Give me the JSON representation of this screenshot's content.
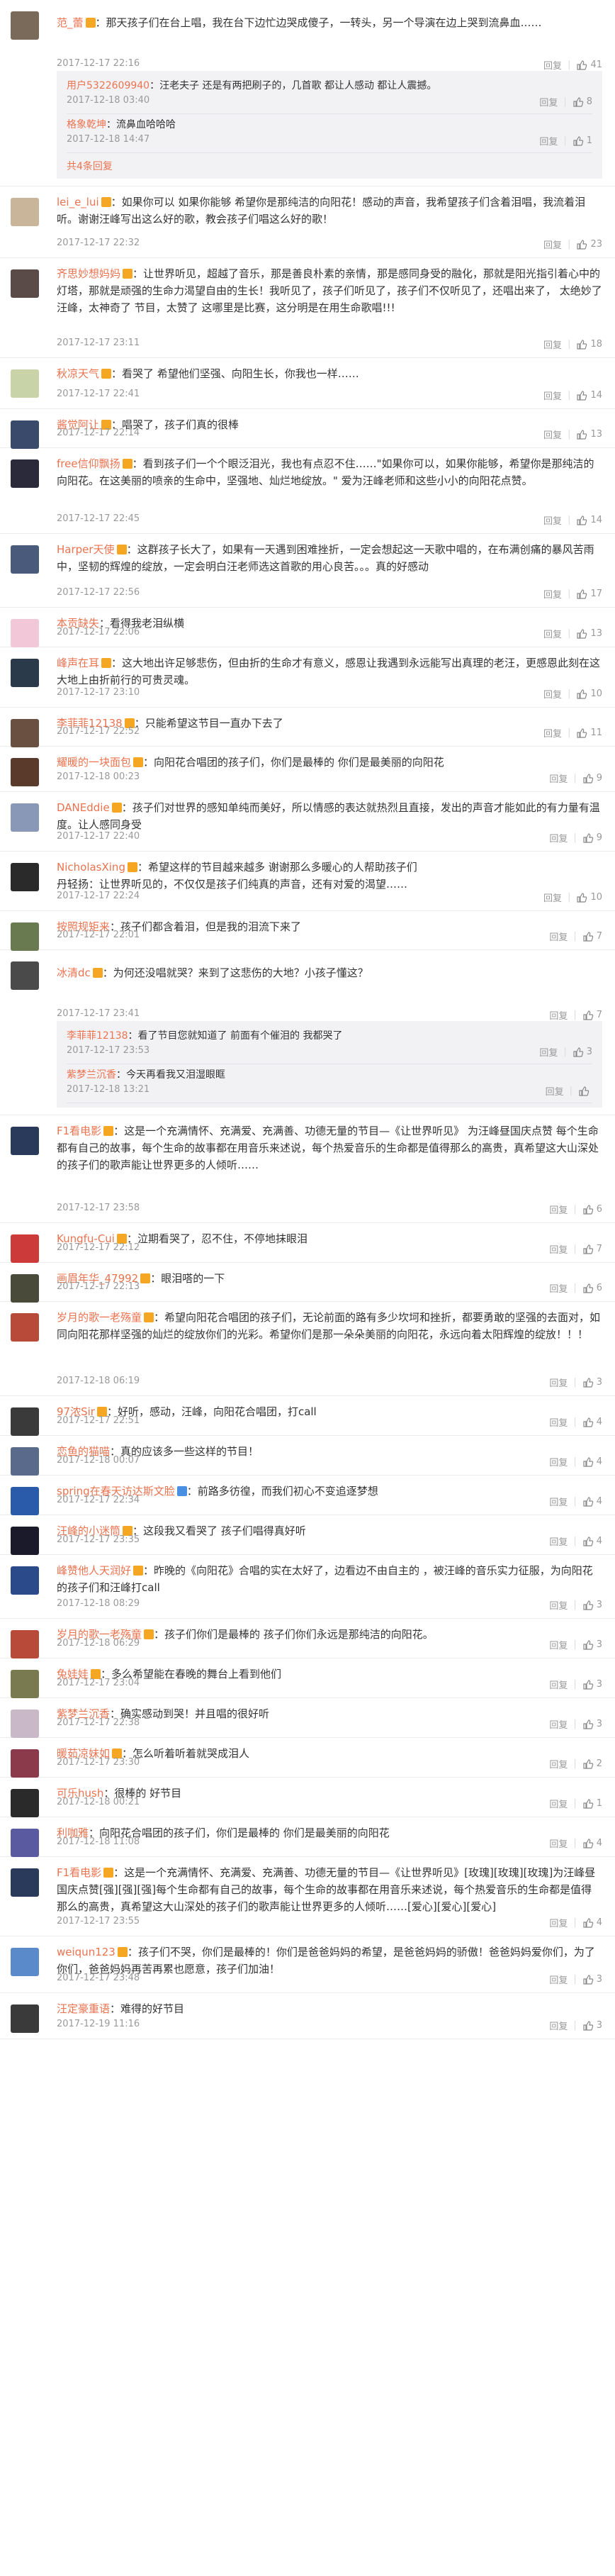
{
  "comments": [
    {
      "user": "范_蕾",
      "badge": "vip",
      "text": "：那天孩子们在台上唱，我在台下边忙边哭成傻子，一转头，另一个导演在边上哭到流鼻血……",
      "time": "2017-12-17 22:16",
      "reply": "回复",
      "likes": "41",
      "av": "#7a6a5a",
      "replies": [
        {
          "user": "用户5322609940",
          "text": "：汪老夫子 还是有两把刷子的，几首歌 都让人感动 都让人震撼。",
          "time": "2017-12-18 03:40",
          "reply": "回复",
          "likes": "8"
        },
        {
          "user": "格象乾坤",
          "text": "：流鼻血哈哈哈",
          "time": "2017-12-18 14:47",
          "reply": "回复",
          "likes": "1"
        }
      ],
      "more": "共4条回复"
    },
    {
      "user": "lei_e_lui",
      "badge": "vip",
      "text": "：如果你可以 如果你能够 希望你是那纯洁的向阳花！感动的声音，我希望孩子们含着泪唱，我流着泪听。谢谢汪峰写出这么好的歌，教会孩子们唱这么好的歌！",
      "time": "2017-12-17 22:32",
      "reply": "回复",
      "likes": "23",
      "av": "#c9b59a"
    },
    {
      "user": "齐思妙想妈妈",
      "badge": "vip",
      "text": "：让世界听见，超越了音乐，那是善良朴素的亲情，那是感同身受的融化，那就是阳光指引着心中的灯塔，那就是顽强的生命力渴望自由的生长！我听见了，孩子们听见了，孩子们不仅听见了，还唱出来了， 太绝妙了 汪峰，太神奇了 节目，太赞了 这哪里是比赛，这分明是在用生命歌唱!!!",
      "time": "2017-12-17 23:11",
      "reply": "回复",
      "likes": "18",
      "av": "#5a4a48"
    },
    {
      "user": "秋凉天气",
      "badge": "vip",
      "text": "：看哭了 希望他们坚强、向阳生长，你我也一样……",
      "time": "2017-12-17 22:41",
      "reply": "回复",
      "likes": "14",
      "av": "#c8d4a8"
    },
    {
      "user": "酱觉阿让",
      "badge": "vip",
      "text": "：唱哭了，孩子们真的很棒",
      "time": "2017-12-17 22:14",
      "reply": "回复",
      "likes": "13",
      "av": "#3a4a6a"
    },
    {
      "user": "free信仰飘扬",
      "badge": "vip",
      "text": "：看到孩子们一个个眼泛泪光，我也有点忍不住……\"如果你可以，如果你能够，希望你是那纯洁的向阳花。在这美丽的喷亲的生命中，坚强地、灿烂地绽放。\" 爱为汪峰老师和这些小小的向阳花点赞。",
      "time": "2017-12-17 22:45",
      "reply": "回复",
      "likes": "14",
      "av": "#2a2a3a"
    },
    {
      "user": "Harper天使",
      "badge": "vip",
      "text": "：这群孩子长大了，如果有一天遇到困难挫折，一定会想起这一天歌中唱的，在布满创痛的暴风苦雨中，坚韧的辉煌的绽放，一定会明白汪老师选这首歌的用心良苦。。。真的好感动",
      "time": "2017-12-17 22:56",
      "reply": "回复",
      "likes": "17",
      "av": "#4a5a7a"
    },
    {
      "user": "本贡缺失",
      "badge": "",
      "text": "：看得我老泪纵横",
      "time": "2017-12-17 22:06",
      "reply": "回复",
      "likes": "13",
      "av": "#f2c8d8"
    },
    {
      "user": "峰声在耳",
      "badge": "vip",
      "text": "：这大地出许足够悲伤，但由折的生命才有意义，感恩让我遇到永远能写出真理的老汪，更感恩此刻在这大地上由折前行的可贵灵魂。",
      "time": "2017-12-17 23:10",
      "reply": "回复",
      "likes": "10",
      "av": "#2a3a4a"
    },
    {
      "user": "李菲菲12138",
      "badge": "vip",
      "text": "：只能希望这节目一直办下去了",
      "time": "2017-12-17 22:52",
      "reply": "回复",
      "likes": "11",
      "av": "#6a5040"
    },
    {
      "user": "耀暖的一块面包",
      "badge": "vip",
      "text": "：向阳花合唱团的孩子们，你们是最棒的 你们是最美丽的向阳花",
      "time": "2017-12-18 00:23",
      "reply": "回复",
      "likes": "9",
      "av": "#5a3a2a"
    },
    {
      "user": "DANEddie",
      "badge": "vip",
      "text": "：孩子们对世界的感知单纯而美好，所以情感的表达就热烈且直接，发出的声音才能如此的有力量有温度。让人感同身受",
      "time": "2017-12-17 22:40",
      "reply": "回复",
      "likes": "9",
      "av": "#8a98b8"
    },
    {
      "user": "NicholasXing",
      "badge": "vip",
      "text": "：希望这样的节目越来越多 谢谢那么多暖心的人帮助孩子们",
      "sub": "丹轻扬：让世界听见的，不仅仅是孩子们纯真的声音，还有对爱的渴望……",
      "time": "2017-12-17 22:24",
      "reply": "回复",
      "likes": "10",
      "av": "#2a2a2a"
    },
    {
      "user": "按照规矩来",
      "badge": "",
      "text": "：孩子们都含着泪，但是我的泪流下来了",
      "time": "2017-12-17 22:01",
      "reply": "回复",
      "likes": "7",
      "av": "#6a7a50"
    },
    {
      "user": "冰清dc",
      "badge": "vip",
      "text": "：为何还没唱就哭？来到了这悲伤的大地？小孩子懂这？",
      "time": "2017-12-17 23:41",
      "reply": "回复",
      "likes": "7",
      "av": "#4a4a4a",
      "replies": [
        {
          "user": "李菲菲12138",
          "text": "：看了节目您就知道了 前面有个催泪的 我都哭了",
          "time": "2017-12-17 23:53",
          "reply": "回复",
          "likes": "3"
        },
        {
          "user": "紫梦兰沉香",
          "text": "：今天再看我又泪湿眼眶",
          "time": "2017-12-18 13:21",
          "reply": "回复",
          "likes": ""
        }
      ]
    },
    {
      "user": "F1看电影",
      "badge": "vip",
      "text": "：这是一个充满情怀、充满爱、充满善、功德无量的节目—《让世界听见》 为汪峰昼国庆点赞 每个生命都有自己的故事，每个生命的故事都在用音乐来述说，每个热爱音乐的生命都是值得那么的高贵，真希望这大山深处的孩子们的歌声能让世界更多的人倾听……",
      "time": "2017-12-17 23:58",
      "reply": "回复",
      "likes": "6",
      "av": "#2a3a5a"
    },
    {
      "user": "Kungfu-Cui",
      "badge": "vip",
      "text": "：泣期看哭了，忍不住，不停地抹眼泪",
      "time": "2017-12-17 22:12",
      "reply": "回复",
      "likes": "7",
      "av": "#cc3a3a"
    },
    {
      "user": "画眉年华_47992",
      "badge": "vip",
      "text": "：眼泪嗒的一下",
      "time": "2017-12-17 22:13",
      "reply": "回复",
      "likes": "6",
      "av": "#4a4a3a"
    },
    {
      "user": "岁月的歌一老殇童",
      "badge": "vip",
      "text": "：希望向阳花合唱团的孩子们，无论前面的路有多少坎坷和挫折，都要勇敢的坚强的去面对，如同向阳花那样坚强的灿烂的绽放你们的光彩。希望你们是那一朵朵美丽的向阳花，永远向着太阳辉煌的绽放！！！",
      "time": "2017-12-18 06:19",
      "reply": "回复",
      "likes": "3",
      "av": "#b84a3a"
    },
    {
      "user": "97浓Sir",
      "badge": "vip",
      "text": "：好听，感动，汪峰，向阳花合唱团，打call",
      "time": "2017-12-17 22:51",
      "reply": "回复",
      "likes": "4",
      "av": "#3a3a3a"
    },
    {
      "user": "恋鱼的猫喵",
      "badge": "",
      "text": "：真的应该多一些这样的节目！",
      "time": "2017-12-18 00:07",
      "reply": "回复",
      "likes": "4",
      "av": "#5a6a8a"
    },
    {
      "user": "spring在春天访达斯文脸",
      "badge": "v",
      "text": "：前路多彷徨，而我们初心不变追逐梦想",
      "time": "2017-12-17 22:34",
      "reply": "回复",
      "likes": "4",
      "av": "#2a5aaa"
    },
    {
      "user": "汪峰的小迷筒",
      "badge": "vip",
      "text": "：这段我又看哭了 孩子们唱得真好听",
      "time": "2017-12-17 23:35",
      "reply": "回复",
      "likes": "4",
      "av": "#1a1a2a"
    },
    {
      "user": "峰赞他人天润好",
      "badge": "vip",
      "text": "：昨晚的《向阳花》合唱的实在太好了，边看边不由自主的 ，被汪峰的音乐实力征服，为向阳花的孩子们和汪峰打call",
      "time": "2017-12-18 08:29",
      "reply": "回复",
      "likes": "3",
      "av": "#2a4a8a"
    },
    {
      "user": "岁月的歌一老殇童",
      "badge": "vip",
      "text": "：孩子们你们是最棒的 孩子们你们永远是那纯洁的向阳花。",
      "time": "2017-12-18 06:29",
      "reply": "回复",
      "likes": "3",
      "av": "#b84a3a"
    },
    {
      "user": "兔娃娃",
      "badge": "vip",
      "text": "：多么希望能在春晚的舞台上看到他们",
      "time": "2017-12-17 23:04",
      "reply": "回复",
      "likes": "3",
      "av": "#7a7a50"
    },
    {
      "user": "紫梦兰沉香",
      "badge": "",
      "text": "：确实感动到哭！并且唱的很好听",
      "time": "2017-12-17 22:38",
      "reply": "回复",
      "likes": "3",
      "av": "#c8b8c8"
    },
    {
      "user": "暖茹凉妹如",
      "badge": "vip",
      "text": "：怎么听着听着就哭成泪人",
      "time": "2017-12-17 23:30",
      "reply": "回复",
      "likes": "2",
      "av": "#8a3a4a"
    },
    {
      "user": "可乐hush",
      "badge": "",
      "text": "：很棒的 好节目",
      "time": "2017-12-18 00:21",
      "reply": "回复",
      "likes": "1",
      "av": "#2a2a2a"
    },
    {
      "user": "利咖雅",
      "badge": "",
      "text": "：向阳花合唱团的孩子们，你们是最棒的 你们是最美丽的向阳花",
      "time": "2017-12-18 11:08",
      "reply": "回复",
      "likes": "4",
      "av": "#5a5aa0"
    },
    {
      "user": "F1看电影",
      "badge": "vip",
      "text": "：这是一个充满情怀、充满爱、充满善、功德无量的节目—《让世界听见》[玫瑰][玫瑰][玫瑰]为汪峰昼国庆点赞[强][强][强]每个生命都有自己的故事，每个生命的故事都在用音乐来述说，每个热爱音乐的生命都是值得那么的高贵，真希望这大山深处的孩子们的歌声能让世界更多的人倾听……[爱心][爱心][爱心]",
      "time": "2017-12-17 23:55",
      "reply": "回复",
      "likes": "4",
      "av": "#2a3a5a"
    },
    {
      "user": "weiqun123",
      "badge": "vip",
      "text": "：孩子们不哭，你们是最棒的！你们是爸爸妈妈的希望，是爸爸妈妈的骄傲！爸爸妈妈爱你们，为了你们，爸爸妈妈再苦再累也愿意，孩子们加油！",
      "time": "2017-12-17 23:48",
      "reply": "回复",
      "likes": "3",
      "av": "#5a8aca"
    },
    {
      "user": "汪定豪重语",
      "badge": "",
      "text": "：难得的好节目",
      "time": "2017-12-19 11:16",
      "reply": "回复",
      "likes": "3",
      "av": "#3a3a3a"
    }
  ]
}
